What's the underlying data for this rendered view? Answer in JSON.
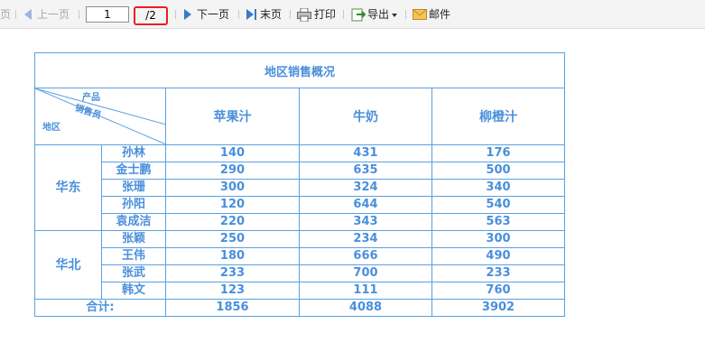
{
  "toolbar": {
    "first_page_label": "页",
    "prev_page_label": "上一页",
    "current_page": "1",
    "total_pages": "/2",
    "next_page_label": "下一页",
    "last_page_label": "末页",
    "print_label": "打印",
    "export_label": "导出",
    "mail_label": "邮件"
  },
  "report": {
    "title": "地区销售概况",
    "header": {
      "diag_product": "产品",
      "diag_salesperson": "销售员",
      "diag_region": "地区",
      "products": [
        "苹果汁",
        "牛奶",
        "柳橙汁"
      ]
    },
    "regions": [
      {
        "name": "华东",
        "rows": [
          {
            "person": "孙林",
            "values": [
              "140",
              "431",
              "176"
            ]
          },
          {
            "person": "金士鹏",
            "values": [
              "290",
              "635",
              "500"
            ]
          },
          {
            "person": "张珊",
            "values": [
              "300",
              "324",
              "340"
            ]
          },
          {
            "person": "孙阳",
            "values": [
              "120",
              "644",
              "540"
            ]
          },
          {
            "person": "袁成洁",
            "values": [
              "220",
              "343",
              "563"
            ]
          }
        ]
      },
      {
        "name": "华北",
        "rows": [
          {
            "person": "张颖",
            "values": [
              "250",
              "234",
              "300"
            ]
          },
          {
            "person": "王伟",
            "values": [
              "180",
              "666",
              "490"
            ]
          },
          {
            "person": "张武",
            "values": [
              "233",
              "700",
              "233"
            ]
          },
          {
            "person": "韩文",
            "values": [
              "123",
              "111",
              "760"
            ]
          }
        ]
      }
    ],
    "total": {
      "label": "合计:",
      "values": [
        "1856",
        "4088",
        "3902"
      ]
    }
  },
  "colors": {
    "report_blue": "#4a8fdc",
    "highlight_red": "#e52222",
    "toolbar_arrow": "#3a78c8"
  }
}
